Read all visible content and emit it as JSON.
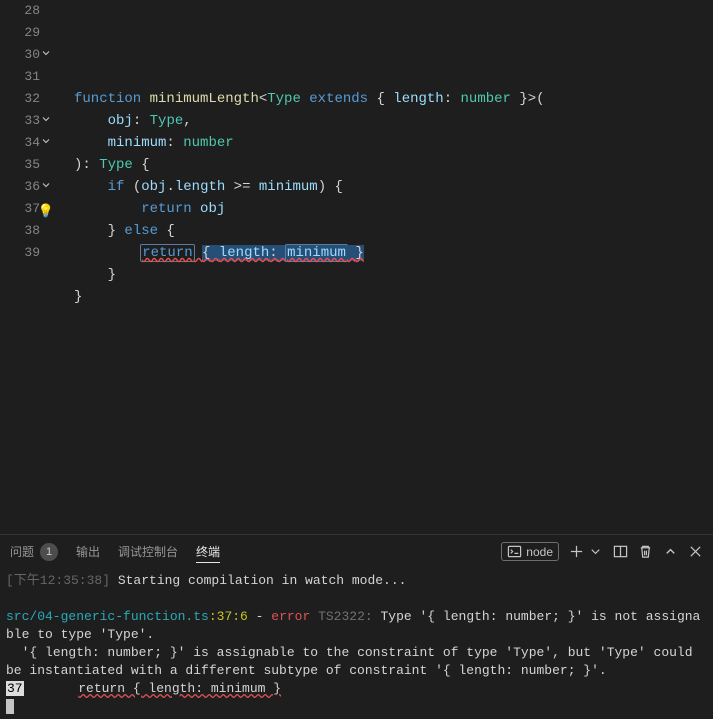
{
  "editor": {
    "lines": [
      {
        "n": 28,
        "tokens": []
      },
      {
        "n": 29,
        "tokens": []
      },
      {
        "n": 30,
        "fold": true,
        "tokens": [
          {
            "t": "function",
            "c": "kw"
          },
          {
            "t": " "
          },
          {
            "t": "minimumLength",
            "c": "fn"
          },
          {
            "t": "<"
          },
          {
            "t": "Type",
            "c": "tp"
          },
          {
            "t": " "
          },
          {
            "t": "extends",
            "c": "kw"
          },
          {
            "t": " { "
          },
          {
            "t": "length",
            "c": "prop"
          },
          {
            "t": ": "
          },
          {
            "t": "number",
            "c": "tp"
          },
          {
            "t": " }>("
          }
        ]
      },
      {
        "n": 31,
        "tokens": [
          {
            "t": "    "
          },
          {
            "t": "obj",
            "c": "prop"
          },
          {
            "t": ": "
          },
          {
            "t": "Type",
            "c": "tp"
          },
          {
            "t": ","
          }
        ]
      },
      {
        "n": 32,
        "tokens": [
          {
            "t": "    "
          },
          {
            "t": "minimum",
            "c": "prop"
          },
          {
            "t": ": "
          },
          {
            "t": "number",
            "c": "tp"
          }
        ]
      },
      {
        "n": 33,
        "fold": true,
        "tokens": [
          {
            "t": "): "
          },
          {
            "t": "Type",
            "c": "tp"
          },
          {
            "t": " {"
          }
        ]
      },
      {
        "n": 34,
        "fold": true,
        "tokens": [
          {
            "t": "    "
          },
          {
            "t": "if",
            "c": "kw"
          },
          {
            "t": " ("
          },
          {
            "t": "obj",
            "c": "prop"
          },
          {
            "t": "."
          },
          {
            "t": "length",
            "c": "prop"
          },
          {
            "t": " >= "
          },
          {
            "t": "minimum",
            "c": "prop"
          },
          {
            "t": ") {"
          }
        ]
      },
      {
        "n": 35,
        "tokens": [
          {
            "t": "        "
          },
          {
            "t": "return",
            "c": "kw"
          },
          {
            "t": " "
          },
          {
            "t": "obj",
            "c": "prop"
          }
        ]
      },
      {
        "n": 36,
        "fold": true,
        "tokens": [
          {
            "t": "    } "
          },
          {
            "t": "else",
            "c": "kw"
          },
          {
            "t": " {"
          }
        ]
      },
      {
        "n": 37,
        "bulb": true,
        "error": true,
        "tokens": [
          {
            "t": "        "
          },
          {
            "t": "return",
            "c": "kw err-underline sel-border"
          },
          {
            "t": " ",
            "c": "err-underline"
          },
          {
            "t": "{",
            "c": "err-underline sel"
          },
          {
            "t": " ",
            "c": "err-underline sel"
          },
          {
            "t": "length",
            "c": "prop err-underline sel"
          },
          {
            "t": ":",
            "c": "err-underline sel"
          },
          {
            "t": " ",
            "c": "err-underline sel"
          },
          {
            "t": "minimum",
            "c": "prop err-underline sel sel-border"
          },
          {
            "t": " ",
            "c": "err-underline sel"
          },
          {
            "t": "}",
            "c": "err-underline sel"
          }
        ]
      },
      {
        "n": 38,
        "tokens": [
          {
            "t": "    }"
          }
        ]
      },
      {
        "n": 39,
        "tokens": [
          {
            "t": "}"
          }
        ]
      }
    ]
  },
  "panel": {
    "tabs": {
      "problems_label": "问题",
      "problems_count": "1",
      "output_label": "输出",
      "debug_label": "调试控制台",
      "terminal_label": "终端"
    },
    "actions": {
      "shell": "node"
    },
    "terminal": {
      "ts": "[下午12:35:38]",
      "starting": " Starting compilation in watch mode...",
      "file": "src/04-generic-function.ts",
      "loc": ":37:6",
      "dash": " - ",
      "err_word": "error",
      "code": " TS2322: ",
      "msg1": "Type '{ length: number; }' is not assignable to type 'Type'.",
      "msg2": "  '{ length: number; }' is assignable to the constraint of type 'Type', but 'Type' could be instantiated with a different subtype of constraint '{ length: number; }'.",
      "ln_label": "37",
      "snippet_pre": "       ",
      "snippet": "return { length: minimum }"
    }
  }
}
